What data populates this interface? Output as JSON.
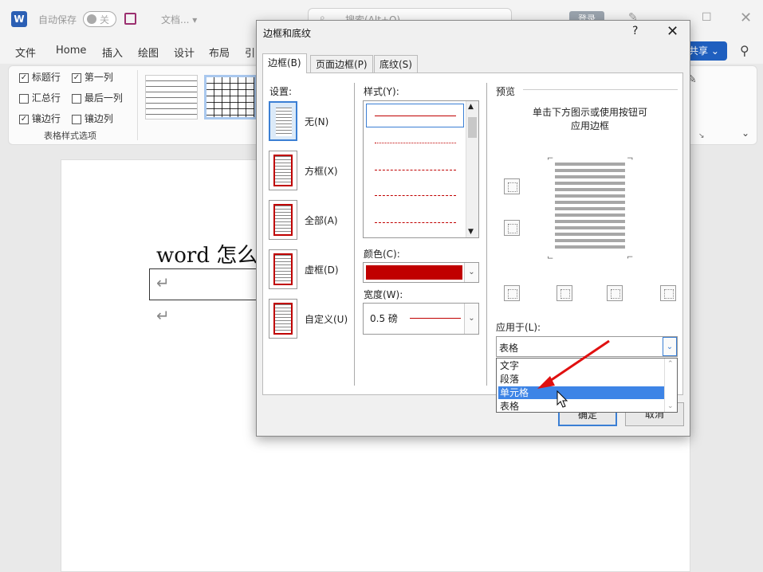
{
  "titlebar": {
    "logo": "W",
    "autosave_label": "自动保存",
    "autosave_state": "关",
    "doc_name": "文档...",
    "search_placeholder": "搜索(Alt+Q)",
    "login_label": "登录"
  },
  "ribbon_tabs": [
    "文件",
    "Home",
    "插入",
    "绘图",
    "设计",
    "布局",
    "引"
  ],
  "share_label": "共享",
  "table_style_options": {
    "items": [
      {
        "label": "标题行",
        "checked": true
      },
      {
        "label": "第一列",
        "checked": true
      },
      {
        "label": "汇总行",
        "checked": false
      },
      {
        "label": "最后一列",
        "checked": false
      },
      {
        "label": "镶边行",
        "checked": true
      },
      {
        "label": "镶边列",
        "checked": false
      }
    ],
    "group_label": "表格样式选项"
  },
  "document": {
    "title": "word 怎么"
  },
  "dialog": {
    "title": "边框和底纹",
    "help": "?",
    "close": "✕",
    "tabs": [
      {
        "label": "边框(B)",
        "active": true
      },
      {
        "label": "页面边框(P)",
        "active": false
      },
      {
        "label": "底纹(S)",
        "active": false
      }
    ],
    "settings_label": "设置:",
    "settings": [
      "无(N)",
      "方框(X)",
      "全部(A)",
      "虚框(D)",
      "自定义(U)"
    ],
    "style_label": "样式(Y):",
    "color_label": "颜色(C):",
    "color_value": "#c00000",
    "width_label": "宽度(W):",
    "width_value": "0.5 磅",
    "preview_label": "预览",
    "preview_hint_1": "单击下方图示或使用按钮可",
    "preview_hint_2": "应用边框",
    "apply_label": "应用于(L):",
    "apply_value": "表格",
    "apply_options": [
      "文字",
      "段落",
      "单元格",
      "表格"
    ],
    "apply_highlighted": "单元格",
    "ok_label": "确定",
    "cancel_label": "取消"
  },
  "colors": {
    "accent": "#3b7fd4",
    "border_red": "#c00000",
    "annotation_arrow": "#e01010"
  }
}
